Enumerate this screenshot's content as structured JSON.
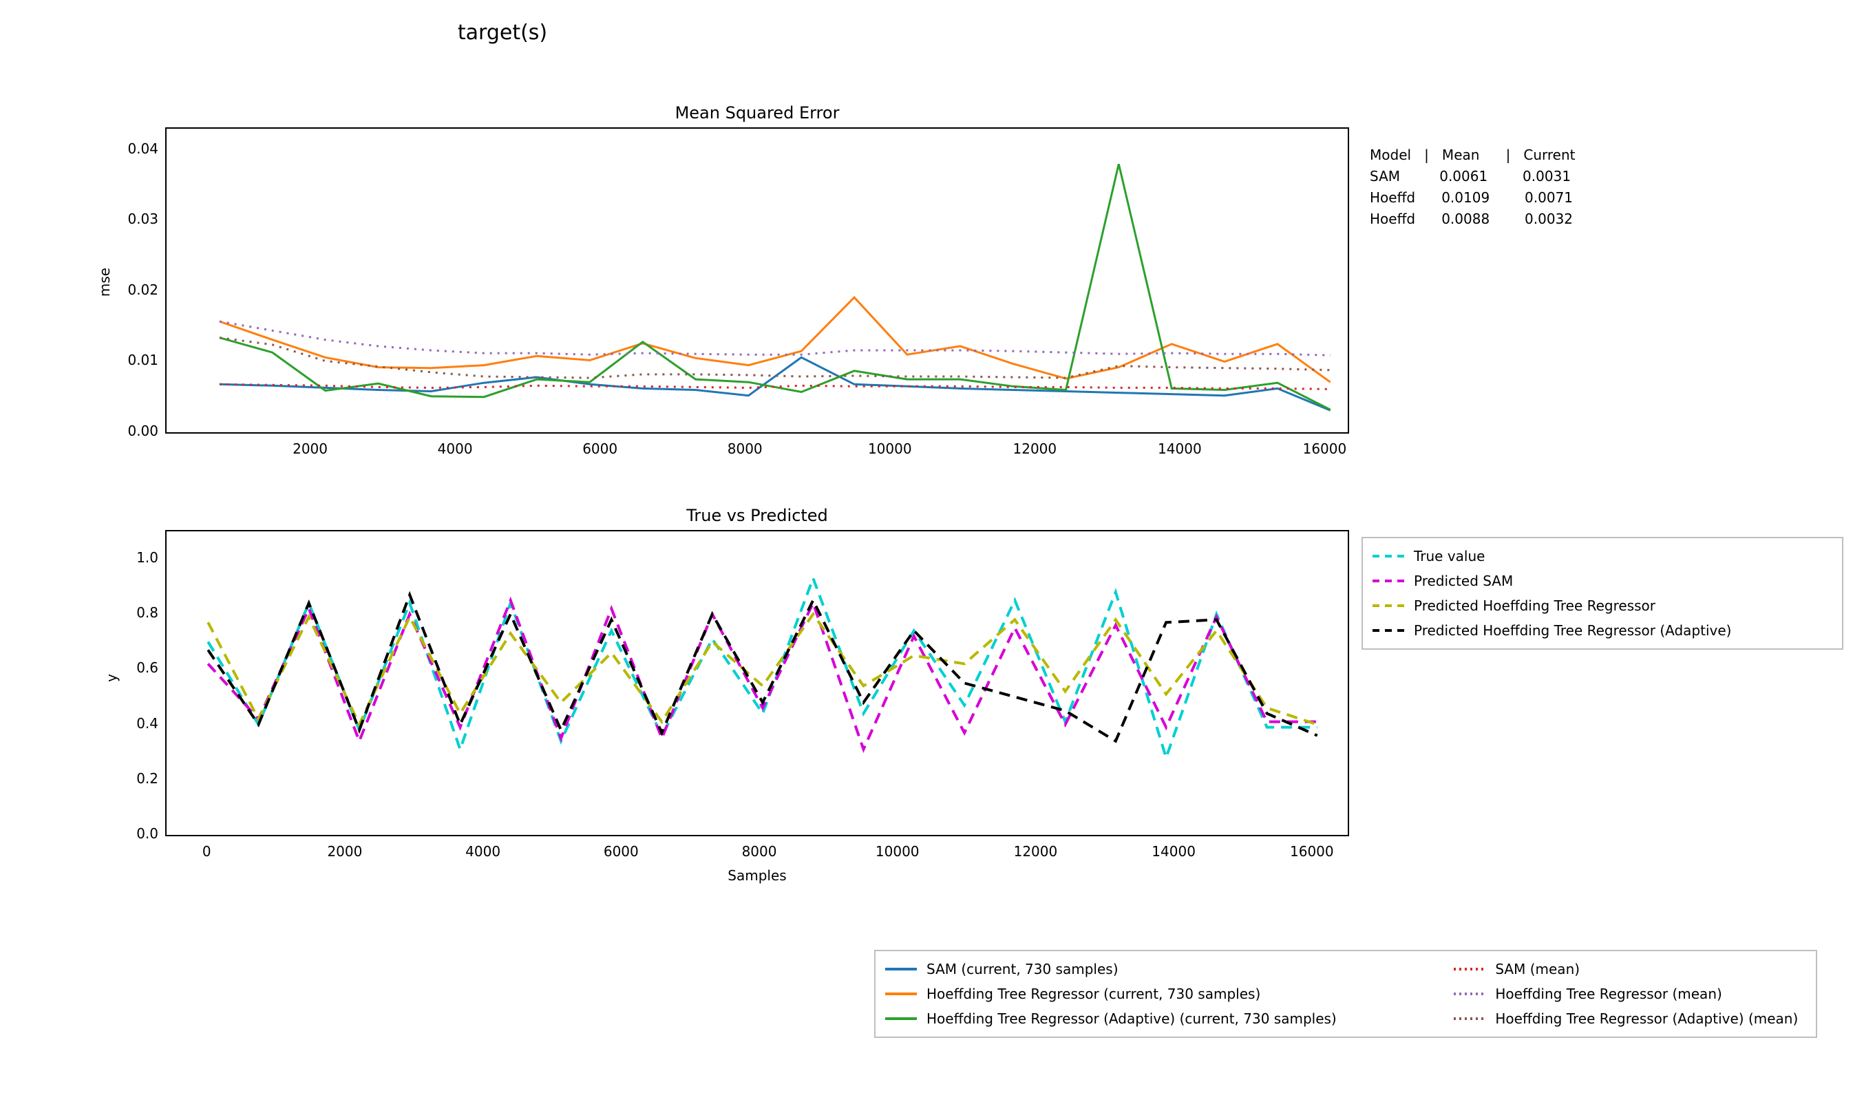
{
  "suptitle": "target(s)",
  "top": {
    "title": "Mean Squared Error",
    "ylabel": "mse",
    "xticks": [
      2000,
      4000,
      6000,
      8000,
      10000,
      12000,
      14000,
      16000
    ],
    "yticks": [
      "0.00",
      "0.01",
      "0.02",
      "0.03",
      "0.04"
    ],
    "xlim": [
      0,
      16300
    ],
    "ylim": [
      0,
      0.043
    ]
  },
  "bottom": {
    "title": "True vs Predicted",
    "ylabel": "y",
    "xlabel": "Samples",
    "xticks": [
      0,
      2000,
      4000,
      6000,
      8000,
      10000,
      12000,
      14000,
      16000
    ],
    "yticks": [
      "0.0",
      "0.2",
      "0.4",
      "0.6",
      "0.8",
      "1.0"
    ],
    "xlim": [
      -600,
      16500
    ],
    "ylim": [
      0,
      1.1
    ]
  },
  "stats": {
    "header": [
      "Model",
      "|",
      "Mean",
      "|",
      "Current"
    ],
    "rows": [
      [
        "SAM",
        "",
        "0.0061",
        "",
        "0.0031"
      ],
      [
        "Hoeffd",
        "",
        "0.0109",
        "",
        "0.0071"
      ],
      [
        "Hoeffd",
        "",
        "0.0088",
        "",
        "0.0032"
      ]
    ]
  },
  "legend_top": [
    {
      "label": "True value",
      "color": "#00d0d0",
      "dash": "10,8"
    },
    {
      "label": "Predicted SAM",
      "color": "#d600d6",
      "dash": "10,8"
    },
    {
      "label": "Predicted Hoeffding Tree Regressor",
      "color": "#b8b800",
      "dash": "10,8"
    },
    {
      "label": "Predicted Hoeffding Tree Regressor (Adaptive)",
      "color": "#000000",
      "dash": "10,8"
    }
  ],
  "legend_bottom_left": [
    {
      "label": "SAM  (current, 730 samples)",
      "color": "#1f77b4",
      "dash": ""
    },
    {
      "label": "Hoeffding Tree Regressor  (current, 730 samples)",
      "color": "#ff7f0e",
      "dash": ""
    },
    {
      "label": "Hoeffding Tree Regressor (Adaptive)  (current, 730 samples)",
      "color": "#2ca02c",
      "dash": ""
    }
  ],
  "legend_bottom_right": [
    {
      "label": "SAM (mean)",
      "color": "#d62728",
      "dash": "3,5"
    },
    {
      "label": "Hoeffding Tree Regressor (mean)",
      "color": "#9467bd",
      "dash": "3,5"
    },
    {
      "label": "Hoeffding Tree Regressor (Adaptive) (mean)",
      "color": "#8c564b",
      "dash": "3,5"
    }
  ],
  "chart_data": [
    {
      "type": "line",
      "title": "Mean Squared Error",
      "xlabel": "Samples",
      "ylabel": "mse",
      "xlim": [
        0,
        16300
      ],
      "ylim": [
        0,
        0.043
      ],
      "x": [
        730,
        1460,
        2190,
        2920,
        3650,
        4380,
        5110,
        5840,
        6570,
        7300,
        8030,
        8760,
        9490,
        10220,
        10950,
        11680,
        12410,
        13140,
        13870,
        14600,
        15330,
        16060
      ],
      "series": [
        {
          "name": "SAM (current, 730 samples)",
          "color": "#1f77b4",
          "style": "solid",
          "values": [
            0.0068,
            0.0066,
            0.0063,
            0.006,
            0.0058,
            0.007,
            0.0078,
            0.0068,
            0.0062,
            0.006,
            0.0052,
            0.0106,
            0.0068,
            0.0065,
            0.0062,
            0.006,
            0.0058,
            0.0056,
            0.0054,
            0.0052,
            0.0062,
            0.0031
          ]
        },
        {
          "name": "Hoeffding Tree Regressor (current, 730 samples)",
          "color": "#ff7f0e",
          "style": "solid",
          "values": [
            0.0157,
            0.0131,
            0.0106,
            0.0092,
            0.0091,
            0.0095,
            0.0108,
            0.0102,
            0.0126,
            0.0105,
            0.0095,
            0.0115,
            0.0191,
            0.011,
            0.0122,
            0.0097,
            0.0076,
            0.0092,
            0.0125,
            0.01,
            0.0125,
            0.0071
          ]
        },
        {
          "name": "Hoeffding Tree Regressor (Adaptive) (current, 730 samples)",
          "color": "#2ca02c",
          "style": "solid",
          "values": [
            0.0134,
            0.0113,
            0.0059,
            0.0069,
            0.0051,
            0.005,
            0.0075,
            0.0071,
            0.0128,
            0.0075,
            0.0071,
            0.0057,
            0.0087,
            0.0075,
            0.0075,
            0.0065,
            0.006,
            0.038,
            0.0062,
            0.006,
            0.007,
            0.0032
          ]
        },
        {
          "name": "SAM (mean)",
          "color": "#d62728",
          "style": "dot",
          "values": [
            0.0068,
            0.0067,
            0.0066,
            0.0064,
            0.0063,
            0.0064,
            0.0066,
            0.0065,
            0.0065,
            0.0064,
            0.0063,
            0.0066,
            0.0065,
            0.0065,
            0.0065,
            0.0064,
            0.0064,
            0.0063,
            0.0063,
            0.0062,
            0.0062,
            0.0061
          ]
        },
        {
          "name": "Hoeffding Tree Regressor (mean)",
          "color": "#9467bd",
          "style": "dot",
          "values": [
            0.0157,
            0.0144,
            0.0131,
            0.0122,
            0.0116,
            0.0112,
            0.0112,
            0.011,
            0.0112,
            0.0111,
            0.011,
            0.011,
            0.0116,
            0.0116,
            0.0116,
            0.0115,
            0.0113,
            0.0111,
            0.0112,
            0.0111,
            0.0111,
            0.0109
          ]
        },
        {
          "name": "Hoeffding Tree Regressor (Adaptive) (mean)",
          "color": "#8c564b",
          "style": "dot",
          "values": [
            0.0134,
            0.0124,
            0.0101,
            0.0093,
            0.0085,
            0.0079,
            0.0078,
            0.0077,
            0.0082,
            0.0082,
            0.0081,
            0.0079,
            0.008,
            0.0079,
            0.0079,
            0.0078,
            0.0077,
            0.0094,
            0.0092,
            0.0091,
            0.009,
            0.0088
          ]
        }
      ]
    },
    {
      "type": "line",
      "title": "True vs Predicted",
      "xlabel": "Samples",
      "ylabel": "y",
      "xlim": [
        -600,
        16500
      ],
      "ylim": [
        0,
        1.1
      ],
      "x": [
        0,
        730,
        1460,
        2190,
        2920,
        3650,
        4380,
        5110,
        5840,
        6570,
        7300,
        8030,
        8760,
        9490,
        10220,
        10950,
        11680,
        12410,
        13140,
        13870,
        14600,
        15330,
        16060
      ],
      "series": [
        {
          "name": "True value",
          "color": "#00d0d0",
          "style": "dash",
          "values": [
            0.7,
            0.4,
            0.84,
            0.38,
            0.84,
            0.31,
            0.84,
            0.34,
            0.74,
            0.36,
            0.71,
            0.44,
            0.93,
            0.44,
            0.74,
            0.47,
            0.85,
            0.41,
            0.88,
            0.28,
            0.8,
            0.39,
            0.39
          ]
        },
        {
          "name": "Predicted SAM",
          "color": "#d600d6",
          "style": "dash",
          "values": [
            0.62,
            0.42,
            0.82,
            0.34,
            0.8,
            0.39,
            0.85,
            0.35,
            0.82,
            0.35,
            0.8,
            0.46,
            0.84,
            0.31,
            0.72,
            0.37,
            0.75,
            0.4,
            0.76,
            0.39,
            0.79,
            0.41,
            0.41
          ]
        },
        {
          "name": "Predicted Hoeffding Tree Regressor",
          "color": "#b8b800",
          "style": "dash",
          "values": [
            0.77,
            0.42,
            0.79,
            0.4,
            0.79,
            0.44,
            0.73,
            0.48,
            0.66,
            0.41,
            0.7,
            0.54,
            0.8,
            0.54,
            0.65,
            0.62,
            0.78,
            0.52,
            0.78,
            0.51,
            0.74,
            0.46,
            0.4
          ]
        },
        {
          "name": "Predicted Hoeffding Tree Regressor (Adaptive)",
          "color": "#000000",
          "style": "dash",
          "values": [
            0.67,
            0.4,
            0.84,
            0.38,
            0.87,
            0.4,
            0.8,
            0.38,
            0.78,
            0.37,
            0.8,
            0.48,
            0.85,
            0.48,
            0.74,
            0.55,
            0.5,
            0.45,
            0.34,
            0.77,
            0.78,
            0.44,
            0.36
          ]
        }
      ]
    }
  ]
}
